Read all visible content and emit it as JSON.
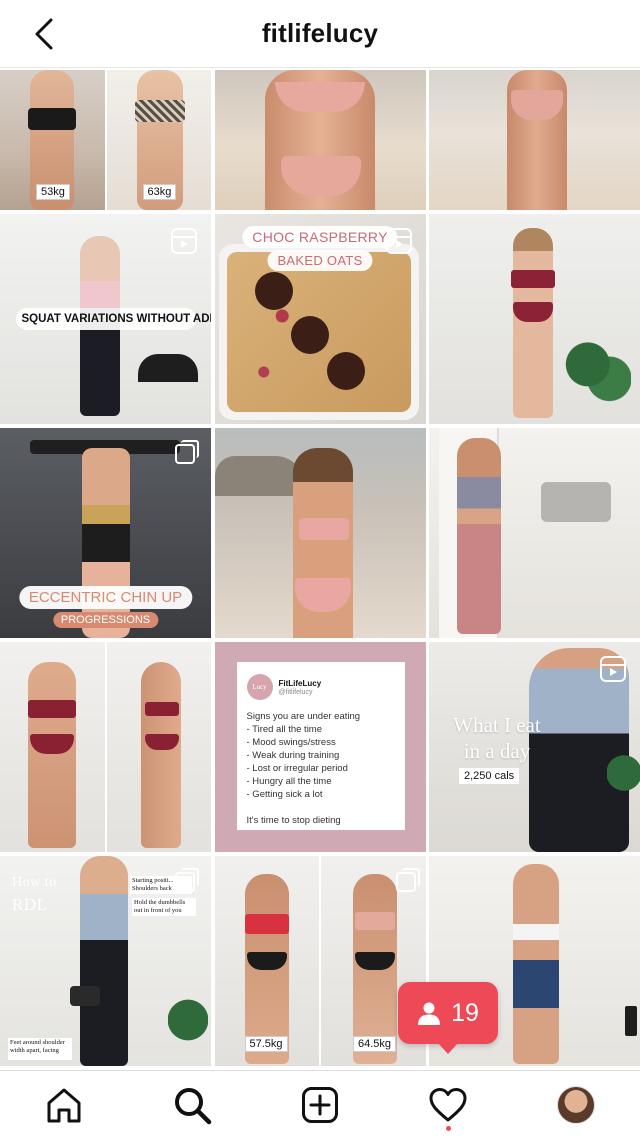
{
  "header": {
    "username": "fitlifelucy"
  },
  "posts": {
    "p1": {
      "labels": [
        "53kg",
        "63kg"
      ]
    },
    "p4": {
      "caption": "SQUAT VARIATIONS WITHOUT ADDING WEIGHT"
    },
    "p5": {
      "title": "CHOC RASPBERRY",
      "subtitle": "BAKED OATS"
    },
    "p7": {
      "title": "ECCENTRIC CHIN UP",
      "subtitle": "PROGRESSIONS"
    },
    "p11": {
      "logo_text": "Lucy",
      "name": "FitLifeLucy",
      "handle": "@fitlifelucy",
      "lines": [
        "Signs you are under eating",
        "- Tired all the time",
        "- Mood swings/stress",
        "- Weak during training",
        "- Lost or irregular period",
        "- Hungry all the time",
        "- Getting sick a lot",
        "",
        "It's time to stop dieting"
      ]
    },
    "p12": {
      "title_line1": "What I eat",
      "title_line2": "in a day",
      "calories": "2,250 cals"
    },
    "p13": {
      "title_line1": "How to",
      "title_line2": "RDL",
      "note1": "Starting positi... Shoulders back",
      "note2": "Hold the dumbbells out in front of you",
      "note3": "Feet around shoulder width apart, facing"
    },
    "p14": {
      "labels": [
        "57.5kg",
        "64.5kg"
      ]
    }
  },
  "notification": {
    "count": "19",
    "icon": "user-icon"
  },
  "nav": {
    "items": [
      "home-icon",
      "search-icon",
      "add-post-icon",
      "activity-heart-icon",
      "profile-avatar"
    ]
  },
  "colors": {
    "notification": "#ed4956",
    "card_bg": "#cfa9b3"
  }
}
